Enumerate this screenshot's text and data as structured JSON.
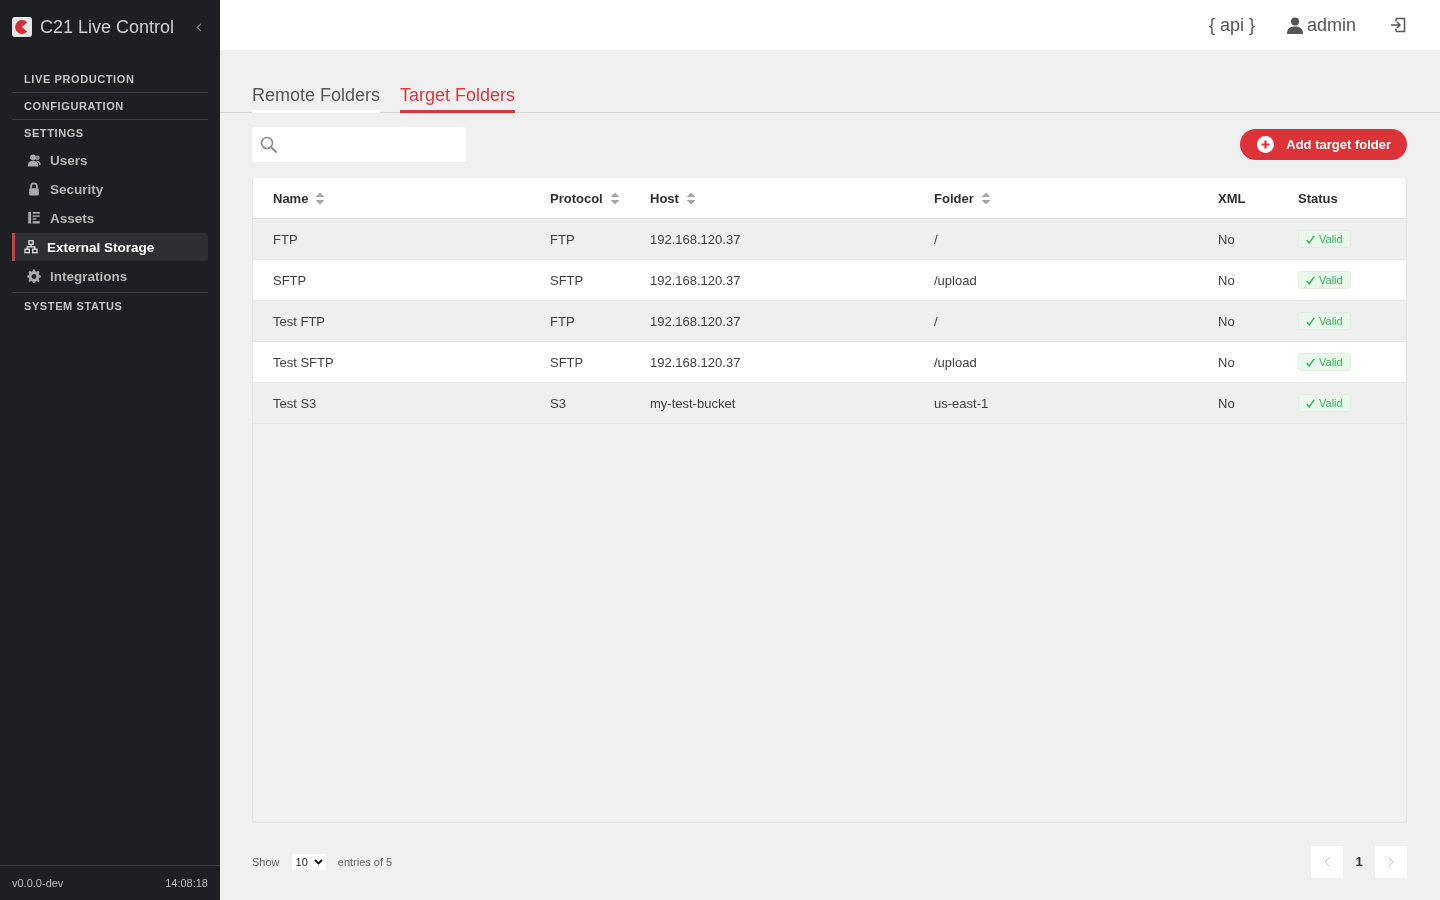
{
  "sidebar": {
    "app_title": "C21 Live Control",
    "nav": [
      {
        "label": "LIVE PRODUCTION"
      },
      {
        "label": "CONFIGURATION"
      },
      {
        "label": "SETTINGS",
        "children": [
          {
            "label": "Users",
            "selected": false
          },
          {
            "label": "Security",
            "selected": false
          },
          {
            "label": "Assets",
            "selected": false
          },
          {
            "label": "External Storage",
            "selected": true
          },
          {
            "label": "Integrations",
            "selected": false
          }
        ]
      },
      {
        "label": "SYSTEM STATUS"
      }
    ],
    "version": "v0.0.0-dev",
    "time": "14:08:18"
  },
  "topbar": {
    "api_link": "{ api }",
    "user": "admin"
  },
  "tabs": [
    {
      "label": "Remote Folders",
      "selected": false
    },
    {
      "label": "Target Folders",
      "selected": true
    }
  ],
  "add_button": "Add target folder",
  "table": {
    "columns": [
      {
        "label": "Name",
        "sortable": true
      },
      {
        "label": "Protocol",
        "sortable": true
      },
      {
        "label": "Host",
        "sortable": true
      },
      {
        "label": "Folder",
        "sortable": true
      },
      {
        "label": "XML",
        "sortable": false
      },
      {
        "label": "Status",
        "sortable": false
      }
    ],
    "rows": [
      {
        "cells": [
          "FTP",
          "FTP",
          "192.168.120.37",
          "/",
          "No"
        ],
        "status": "Valid"
      },
      {
        "cells": [
          "SFTP",
          "SFTP",
          "192.168.120.37",
          "/upload",
          "No"
        ],
        "status": "Valid"
      },
      {
        "cells": [
          "Test FTP",
          "FTP",
          "192.168.120.37",
          "/",
          "No"
        ],
        "status": "Valid"
      },
      {
        "cells": [
          "Test SFTP",
          "SFTP",
          "192.168.120.37",
          "/upload",
          "No"
        ],
        "status": "Valid"
      },
      {
        "cells": [
          "Test S3",
          "S3",
          "my-test-bucket",
          "us-east-1",
          "No"
        ],
        "status": "Valid"
      }
    ]
  },
  "pagination": {
    "show_label": "Show",
    "page_size": "10",
    "entries_label": "entries of 5",
    "pages": [
      {
        "label": "1",
        "selected": true
      }
    ]
  }
}
